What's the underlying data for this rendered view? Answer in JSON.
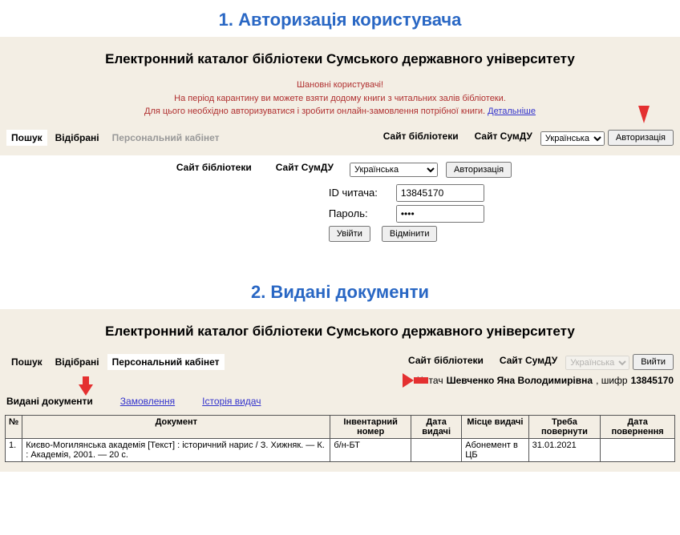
{
  "step1": {
    "title": "1. Авторизація користувача",
    "header": "Електронний каталог бібліотеки Сумського державного університету",
    "notice_line1": "Шановні користувачі!",
    "notice_line2": "На період карантину ви можете взяти додому книги з читальних залів бібліотеки.",
    "notice_line3_pre": "Для цього необхідно авторизуватися і зробити онлайн-замовлення потрібної книги. ",
    "notice_more": "Детальніше",
    "tabs": {
      "search": "Пошук",
      "selected": "Відібрані",
      "cabinet": "Персональний кабінет"
    },
    "site_lib": "Сайт бібліотеки",
    "site_sumdu": "Сайт СумДУ",
    "lang": "Українська",
    "auth_btn": "Авторизація",
    "login": {
      "id_label": "ID читача:",
      "id_value": "13845170",
      "pw_label": "Пароль:",
      "pw_value": "••••",
      "login_btn": "Увійти",
      "cancel_btn": "Відмінити"
    }
  },
  "step2": {
    "title": "2. Видані документи",
    "header": "Електронний каталог бібліотеки Сумського державного університету",
    "tabs": {
      "search": "Пошук",
      "selected": "Відібрані",
      "cabinet": "Персональний кабінет"
    },
    "site_lib": "Сайт бібліотеки",
    "site_sumdu": "Сайт СумДУ",
    "lang": "Українська",
    "logout_btn": "Вийти",
    "reader_pre": "Читач ",
    "reader_name": "Шевченко Яна Володимирівна",
    "reader_code_label": ", шифр ",
    "reader_code": "13845170",
    "subtabs": {
      "issued": "Видані документи",
      "orders": "Замовлення",
      "history": "Історія видач"
    },
    "table": {
      "headers": {
        "num": "№",
        "doc": "Документ",
        "inv": "Інвентарний номер",
        "issue_date": "Дата видачі",
        "place": "Місце видачі",
        "due": "Треба повернути",
        "return_date": "Дата повернення"
      },
      "rows": [
        {
          "num": "1.",
          "doc": "Києво-Могилянська академія [Текст] : історичний нарис / З. Хижняк. — К. : Академія, 2001. — 20 с.",
          "inv": "б/н-БТ",
          "issue_date": "",
          "place": "Абонемент в ЦБ",
          "due": "31.01.2021",
          "return_date": ""
        }
      ]
    }
  }
}
